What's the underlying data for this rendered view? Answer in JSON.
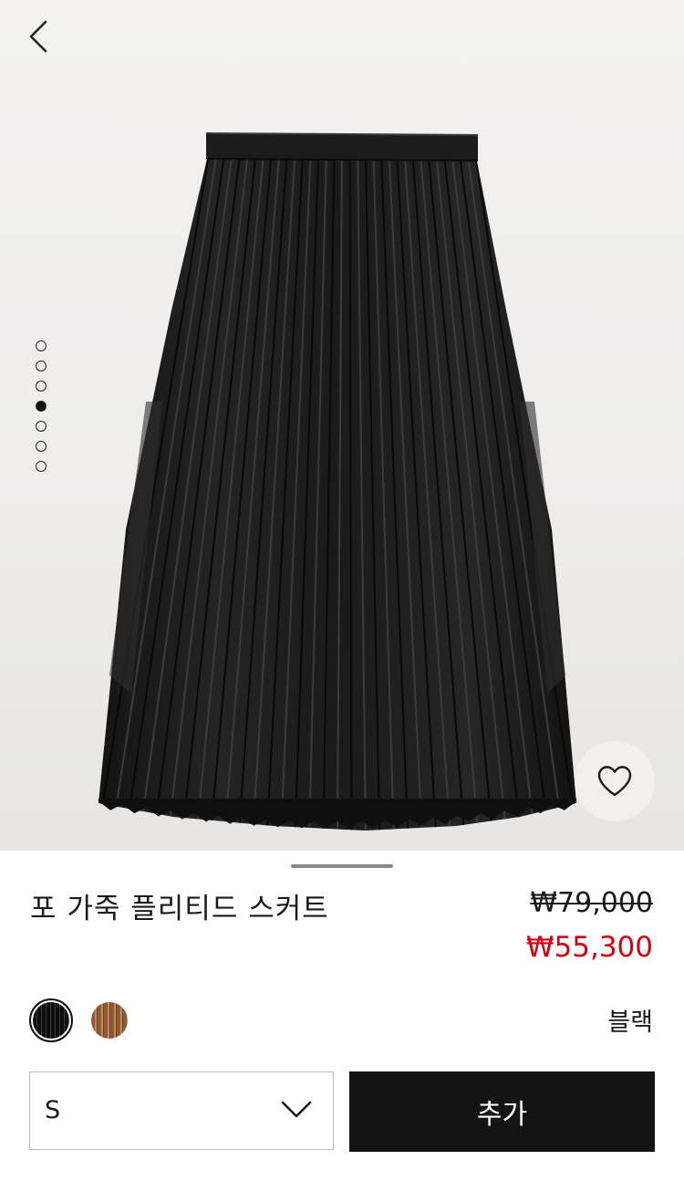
{
  "hero": {
    "back_icon": "chevron-left-icon",
    "image_alt": "skirt-image",
    "carousel": {
      "total": 7,
      "active_index": 3
    },
    "wishlist_icon": "heart-outline-icon"
  },
  "product": {
    "title": "포 가죽 플리티드 스커트",
    "price_original": "₩79,000",
    "price_sale": "₩55,300",
    "color_name": "블랙",
    "swatches": [
      {
        "name": "블랙",
        "color": "#0d0d0d",
        "selected": true
      },
      {
        "name": "brown",
        "color": "#8d5a33",
        "selected": false
      }
    ]
  },
  "size_select": {
    "value": "S",
    "icon": "chevron-down-icon"
  },
  "add_button": {
    "label": "추가",
    "color": "#141414"
  },
  "colors": {
    "sale_price": "#d4000f",
    "text": "#1a1a1a"
  }
}
